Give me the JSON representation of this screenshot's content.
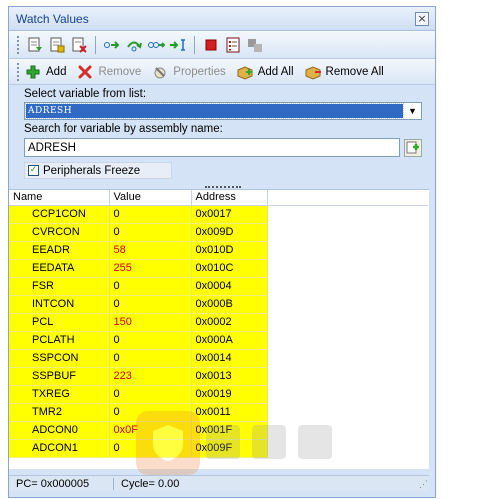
{
  "window": {
    "title": "Watch Values",
    "close_glyph": "×"
  },
  "toolbar_icons": [
    "import-icon",
    "export-icon",
    "delete-watch-icon",
    "step-into-icon",
    "step-over-icon",
    "step-out-icon",
    "run-to-cursor-icon",
    "stop-icon",
    "list-icon",
    "settings-disabled-icon"
  ],
  "actions": {
    "add": "Add",
    "remove": "Remove",
    "properties": "Properties",
    "add_all": "Add All",
    "remove_all": "Remove All"
  },
  "select": {
    "label": "Select variable from list:",
    "value": "ADRESH"
  },
  "search": {
    "label": "Search for variable by assembly name:",
    "value": "ADRESH"
  },
  "freeze": {
    "label": "Peripherals Freeze",
    "checked": true,
    "check_glyph": "✓"
  },
  "columns": {
    "name": "Name",
    "value": "Value",
    "address": "Address"
  },
  "rows": [
    {
      "name": "CCP1CON",
      "value": "0",
      "address": "0x0017",
      "changed": false
    },
    {
      "name": "CVRCON",
      "value": "0",
      "address": "0x009D",
      "changed": false
    },
    {
      "name": "EEADR",
      "value": "58",
      "address": "0x010D",
      "changed": true
    },
    {
      "name": "EEDATA",
      "value": "255",
      "address": "0x010C",
      "changed": true
    },
    {
      "name": "FSR",
      "value": "0",
      "address": "0x0004",
      "changed": false
    },
    {
      "name": "INTCON",
      "value": "0",
      "address": "0x000B",
      "changed": false
    },
    {
      "name": "PCL",
      "value": "150",
      "address": "0x0002",
      "changed": true
    },
    {
      "name": "PCLATH",
      "value": "0",
      "address": "0x000A",
      "changed": false
    },
    {
      "name": "SSPCON",
      "value": "0",
      "address": "0x0014",
      "changed": false
    },
    {
      "name": "SSPBUF",
      "value": "223",
      "address": "0x0013",
      "changed": true
    },
    {
      "name": "TXREG",
      "value": "0",
      "address": "0x0019",
      "changed": false
    },
    {
      "name": "TMR2",
      "value": "0",
      "address": "0x0011",
      "changed": false
    },
    {
      "name": "ADCON0",
      "value": "0x0F",
      "address": "0x001F",
      "changed": true
    },
    {
      "name": "ADCON1",
      "value": "0",
      "address": "0x009F",
      "changed": false
    }
  ],
  "status": {
    "pc": "PC= 0x000005",
    "cycle": "Cycle= 0.00"
  },
  "colors": {
    "row_bg": "#ffff00",
    "changed_value": "#d00000",
    "selection": "#316ac5"
  }
}
